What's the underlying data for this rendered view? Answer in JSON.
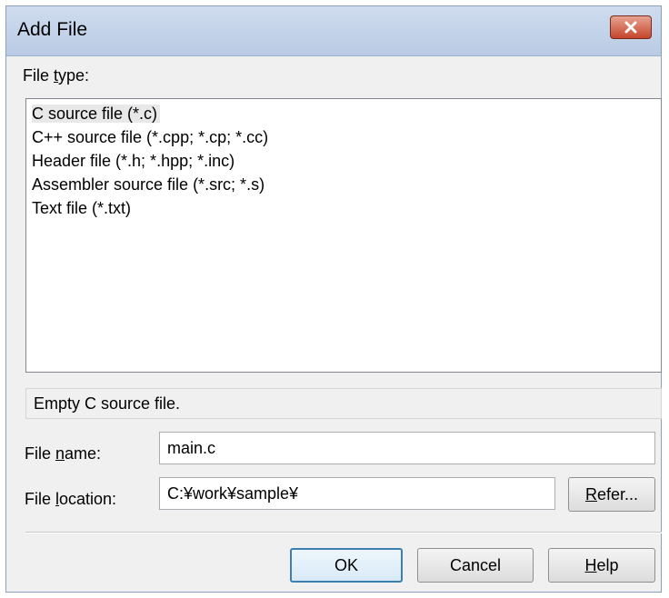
{
  "window": {
    "title": "Add File",
    "close_icon": "close-icon"
  },
  "file_type": {
    "label_prefix": "File ",
    "label_accel": "t",
    "label_suffix": "ype:",
    "items": [
      "C source file (*.c)",
      "C++ source file (*.cpp; *.cp; *.cc)",
      "Header file (*.h; *.hpp; *.inc)",
      "Assembler source file (*.src; *.s)",
      "Text file (*.txt)"
    ],
    "selected_index": 0
  },
  "description": "Empty C source file.",
  "file_name": {
    "label_prefix": "File ",
    "label_accel": "n",
    "label_suffix": "ame:",
    "value": "main.c"
  },
  "file_location": {
    "label_prefix": "File ",
    "label_accel": "l",
    "label_suffix": "ocation:",
    "value": "C:¥work¥sample¥"
  },
  "buttons": {
    "refer_accel": "R",
    "refer_rest": "efer...",
    "ok": "OK",
    "cancel": "Cancel",
    "help_accel": "H",
    "help_rest": "elp"
  },
  "colors": {
    "title_bar": "#c4d4ea",
    "close_button": "#c4452b",
    "default_button_border": "#3c7fb1"
  }
}
